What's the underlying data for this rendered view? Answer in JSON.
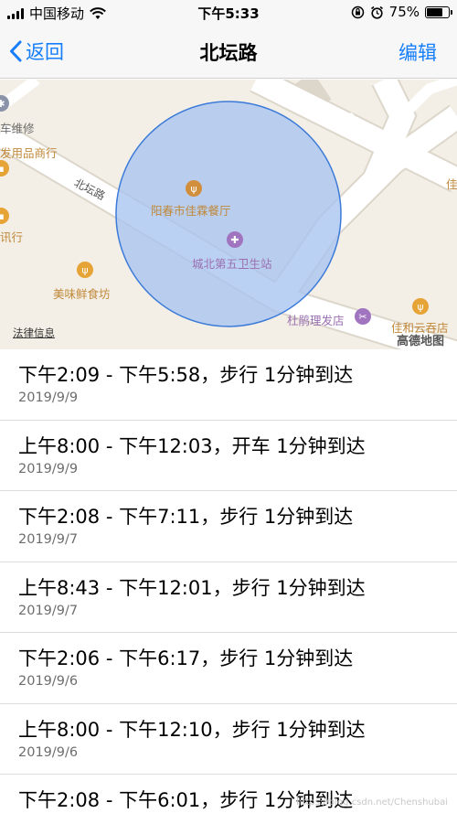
{
  "status_bar": {
    "carrier": "中国移动",
    "time": "下午5:33",
    "battery": "75%",
    "battery_level": 0.75
  },
  "nav": {
    "back_label": "返回",
    "title": "北坛路",
    "edit_label": "编辑"
  },
  "map": {
    "pois": {
      "car_repair": "车维修",
      "supplies_store": "发用品商行",
      "communications": "讯行",
      "restaurant_jialin": "阳春市佳霖餐厅",
      "health_station": "城北第五卫生站",
      "meiwei_food": "美味鲜食坊",
      "barber": "杜鹃理发店",
      "jiahe_restaurant": "佳和云吞店",
      "right_edge_label": "佳"
    },
    "road_name": "北坛路",
    "legal_info": "法律信息",
    "brand": "高德地图"
  },
  "visits": [
    {
      "title": "下午2:09 - 下午5:58，步行 1分钟到达",
      "date": "2019/9/9"
    },
    {
      "title": "上午8:00 - 下午12:03，开车 1分钟到达",
      "date": "2019/9/9"
    },
    {
      "title": "下午2:08 - 下午7:11，步行 1分钟到达",
      "date": "2019/9/7"
    },
    {
      "title": "上午8:43 - 下午12:01，步行 1分钟到达",
      "date": "2019/9/7"
    },
    {
      "title": "下午2:06 - 下午6:17，步行 1分钟到达",
      "date": "2019/9/6"
    },
    {
      "title": "上午8:00 - 下午12:10，步行 1分钟到达",
      "date": "2019/9/6"
    },
    {
      "title": "下午2:08 - 下午6:01，步行 1分钟到达",
      "date": ""
    }
  ],
  "watermark": "https://blog.csdn.net/Chenshubai",
  "colors": {
    "accent": "#157efb",
    "region_fill": "#a8c4f0",
    "region_stroke": "#3b7ad9"
  }
}
